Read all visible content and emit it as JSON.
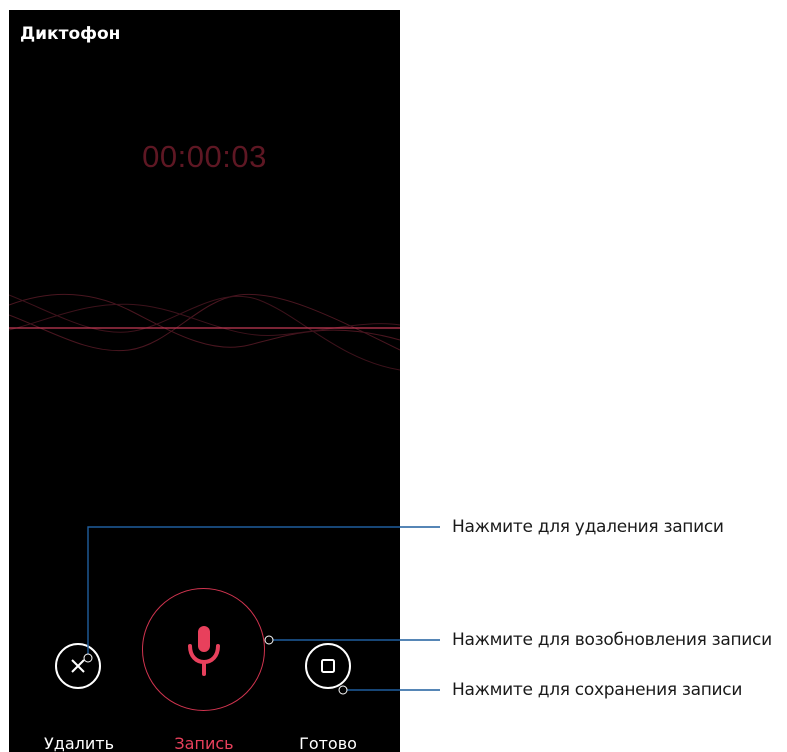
{
  "app": {
    "title": "Диктофон"
  },
  "timer": {
    "value": "00:00:03"
  },
  "buttons": {
    "delete_label": "Удалить",
    "record_label": "Запись",
    "done_label": "Готово"
  },
  "callouts": {
    "delete": "Нажмите для удаления записи",
    "resume": "Нажмите для возобновления записи",
    "save": "Нажмите для сохранения записи"
  },
  "colors": {
    "accent": "#e8405c",
    "timer": "#5e1723",
    "callout_line": "#1f5e9e",
    "background": "#000000"
  },
  "icons": {
    "delete": "close-icon",
    "record": "microphone-icon",
    "done": "stop-icon"
  }
}
